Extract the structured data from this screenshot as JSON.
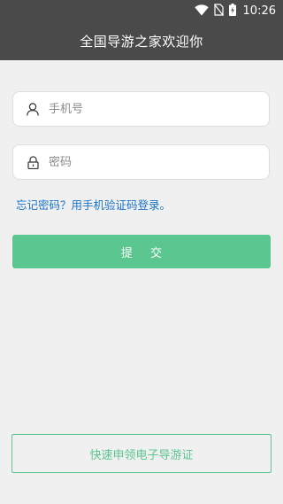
{
  "status_bar": {
    "time": "10:26",
    "icons": [
      "wifi-icon",
      "no-sim-icon",
      "battery-charging-icon"
    ]
  },
  "header": {
    "title": "全国导游之家欢迎你"
  },
  "login_form": {
    "phone_placeholder": "手机号",
    "phone_value": "",
    "phone_icon": "user-icon",
    "password_placeholder": "密码",
    "password_value": "",
    "password_icon": "lock-icon",
    "forgot_link": "忘记密码？用手机验证码登录。",
    "submit_label": "提 交"
  },
  "footer": {
    "apply_label": "快速申领电子导游证"
  },
  "colors": {
    "header_bg": "#4a4a4a",
    "page_bg": "#f0f0f0",
    "accent_green": "#5bc68f",
    "link_blue": "#1a73c8"
  }
}
